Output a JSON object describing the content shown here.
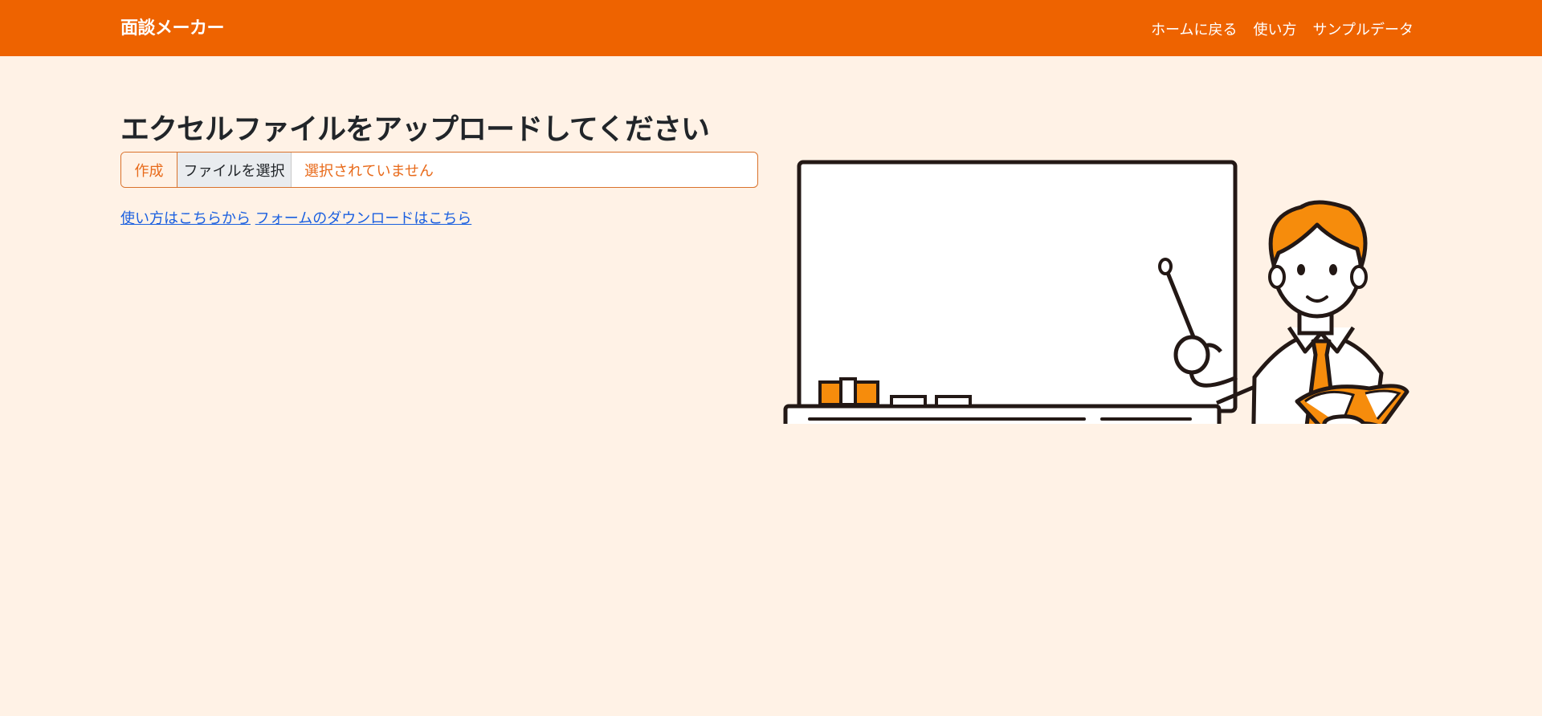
{
  "navbar": {
    "brand": "面談メーカー",
    "links": [
      {
        "label": "ホームに戻る"
      },
      {
        "label": "使い方"
      },
      {
        "label": "サンプルデータ"
      }
    ]
  },
  "main": {
    "heading": "エクセルファイルをアップロードしてください",
    "upload": {
      "create_label": "作成",
      "choose_label": "ファイルを選択",
      "status": "選択されていません"
    },
    "links": [
      {
        "label": "使い方はこちらから"
      },
      {
        "label": "フォームのダウンロードはこちら"
      }
    ]
  },
  "colors": {
    "navbar": "#ee6300",
    "background": "#fff2e6",
    "accent": "#e86a1a",
    "link": "#1a5fe0",
    "tie": "#f68c0c"
  },
  "illustration": {
    "icon": "teacher-whiteboard-illustration"
  }
}
